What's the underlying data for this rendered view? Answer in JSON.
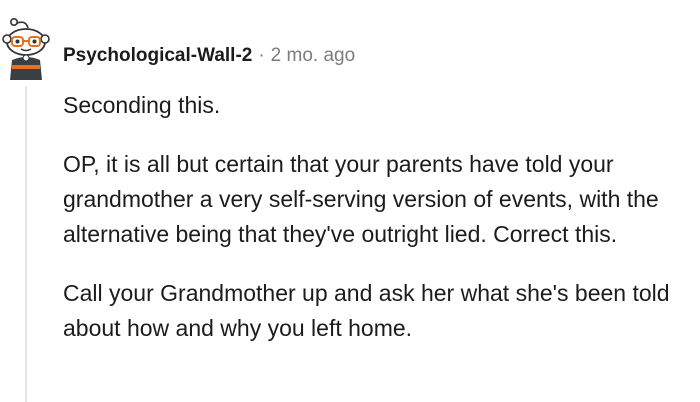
{
  "comment": {
    "author": "Psychological-Wall-2",
    "separator": "·",
    "timestamp": "2 mo. ago",
    "avatar_icon": "reddit-snoo-avatar-icon",
    "paragraphs": [
      "Seconding this.",
      "OP, it is all but certain that your parents have told your grandmother a very self-serving version of events, with the alternative being that they've outright lied. Correct this.",
      "Call your Grandmother up and ask her what she's been told about how and why you left home."
    ]
  },
  "colors": {
    "text": "#1c1c1c",
    "meta": "#7c7c7c",
    "thread_line": "#e3e6e8",
    "avatar_shirt": "#3a3f44",
    "avatar_stripe": "#e8701a"
  }
}
